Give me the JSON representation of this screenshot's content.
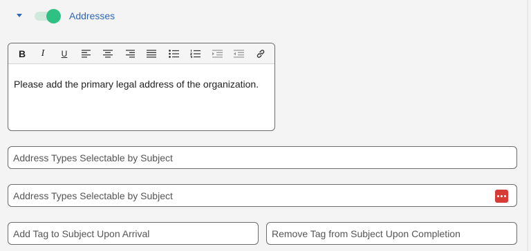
{
  "section": {
    "title": "Addresses",
    "enabled": true
  },
  "editor": {
    "toolbar": {
      "bold": "B",
      "italic": "I",
      "underline": "U"
    },
    "content": "Please add the primary legal address of the organization."
  },
  "fields": {
    "address_types_1": {
      "placeholder": "Address Types Selectable by Subject"
    },
    "address_types_2": {
      "placeholder": "Address Types Selectable by Subject"
    },
    "add_tag": {
      "placeholder": "Add Tag to Subject Upon Arrival"
    },
    "remove_tag": {
      "placeholder": "Remove Tag from Subject Upon Completion"
    }
  },
  "colors": {
    "accent": "#2f66b3",
    "toggle_on": "#2fc183",
    "more_button": "#d63b35"
  }
}
